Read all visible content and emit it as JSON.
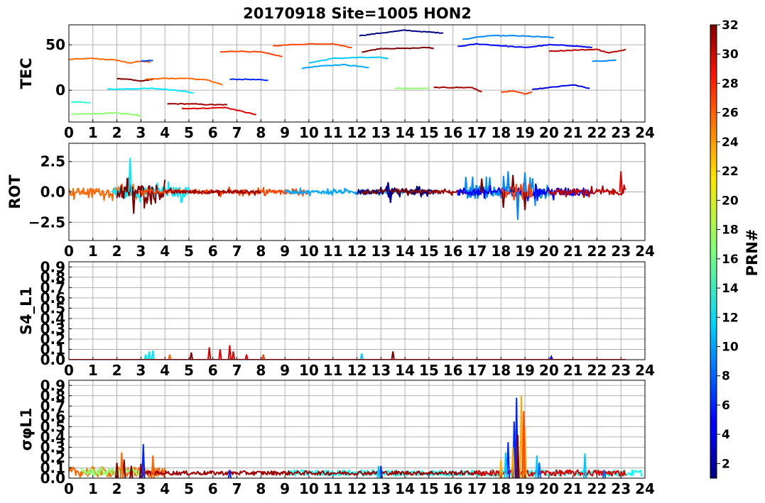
{
  "figure": {
    "title": "20170918 Site=1005 HON2",
    "colorbar": {
      "label": "PRN#",
      "min": 1,
      "max": 32,
      "ticks": [
        2,
        4,
        6,
        8,
        10,
        12,
        14,
        16,
        18,
        20,
        22,
        24,
        26,
        28,
        30,
        32
      ]
    }
  },
  "chart_data": [
    {
      "type": "line",
      "panel": "TEC",
      "ylabel": "TEC",
      "xlim": [
        0,
        24
      ],
      "ylim": [
        -35,
        72
      ],
      "xticks": [
        "0",
        "1",
        "2",
        "3",
        "4",
        "5",
        "6",
        "7",
        "8",
        "9",
        "10",
        "11",
        "12",
        "13",
        "14",
        "15",
        "16",
        "17",
        "18",
        "19",
        "20",
        "21",
        "22",
        "23",
        "24"
      ],
      "yticks": [
        {
          "v": 50,
          "label": "50"
        },
        {
          "v": 0,
          "label": "0"
        }
      ],
      "grid": true,
      "series": [
        {
          "prn": 25,
          "x": [
            0,
            1.0,
            2.0,
            2.5,
            3.0,
            3.4
          ],
          "y": [
            34,
            35,
            33,
            30,
            32,
            31
          ]
        },
        {
          "prn": 7,
          "x": [
            3.0,
            3.5
          ],
          "y": [
            32,
            33
          ]
        },
        {
          "prn": 32,
          "x": [
            2.0,
            2.5,
            3.0,
            3.5
          ],
          "y": [
            13,
            12,
            10,
            12
          ]
        },
        {
          "prn": 25,
          "x": [
            3.2,
            4.0,
            5.0,
            5.8,
            6.4
          ],
          "y": [
            12,
            13,
            13,
            11,
            6
          ]
        },
        {
          "prn": 12,
          "x": [
            1.6,
            2.5,
            3.5,
            4.5,
            5.2
          ],
          "y": [
            1,
            1.5,
            2,
            0,
            -3
          ]
        },
        {
          "prn": 14,
          "x": [
            0.1,
            0.5,
            0.9
          ],
          "y": [
            -13,
            -13,
            -14
          ]
        },
        {
          "prn": 17,
          "x": [
            0.1,
            1.0,
            2.0,
            2.8,
            3.0
          ],
          "y": [
            -26,
            -26,
            -25,
            -27,
            -29
          ]
        },
        {
          "prn": 31,
          "x": [
            4.1,
            5.0,
            6.0,
            6.6
          ],
          "y": [
            -15,
            -15,
            -16,
            -16
          ]
        },
        {
          "prn": 29,
          "x": [
            4.7,
            5.5,
            6.5,
            7.0,
            7.8
          ],
          "y": [
            -20,
            -20,
            -19,
            -22,
            -27
          ]
        },
        {
          "prn": 26,
          "x": [
            6.3,
            7.0,
            8.0,
            8.9
          ],
          "y": [
            42,
            43,
            42,
            37
          ]
        },
        {
          "prn": 6,
          "x": [
            6.7,
            7.5,
            8.3
          ],
          "y": [
            12,
            12,
            11
          ]
        },
        {
          "prn": 26,
          "x": [
            8.5,
            10.0,
            11.0,
            11.8
          ],
          "y": [
            49,
            51,
            51,
            47
          ]
        },
        {
          "prn": 10,
          "x": [
            9.7,
            10.5,
            11.5,
            12.5
          ],
          "y": [
            24,
            27,
            28,
            25
          ]
        },
        {
          "prn": 11,
          "x": [
            10.0,
            11.0,
            12.0,
            13.0,
            13.3
          ],
          "y": [
            30,
            35,
            36,
            36,
            35
          ]
        },
        {
          "prn": 1,
          "x": [
            12.1,
            13.0,
            14.0,
            15.0,
            15.6
          ],
          "y": [
            60,
            63,
            66,
            64,
            63
          ]
        },
        {
          "prn": 32,
          "x": [
            12.2,
            13.0,
            14.0,
            15.0,
            15.2
          ],
          "y": [
            42,
            46,
            46,
            47,
            46
          ]
        },
        {
          "prn": 17,
          "x": [
            13.6,
            14.3,
            15.0
          ],
          "y": [
            2,
            2,
            2
          ]
        },
        {
          "prn": 31,
          "x": [
            15.2,
            16.0,
            16.8,
            17.2
          ],
          "y": [
            3,
            3,
            3,
            -2
          ]
        },
        {
          "prn": 9,
          "x": [
            16.4,
            17.5,
            18.5,
            19.5,
            20.2
          ],
          "y": [
            56,
            60,
            60,
            59,
            58
          ]
        },
        {
          "prn": 5,
          "x": [
            16.2,
            17.0,
            18.0,
            19.0,
            20.0,
            21.0,
            21.8
          ],
          "y": [
            48,
            51,
            49,
            47,
            50,
            49,
            47
          ]
        },
        {
          "prn": 26,
          "x": [
            18.0,
            18.5,
            19.0,
            19.3
          ],
          "y": [
            -2,
            -1,
            -4,
            -2
          ]
        },
        {
          "prn": 4,
          "x": [
            19.3,
            20.0,
            21.0,
            21.7
          ],
          "y": [
            1,
            3,
            6,
            2
          ]
        },
        {
          "prn": 30,
          "x": [
            20.0,
            21.0,
            22.0,
            22.5,
            23.2
          ],
          "y": [
            43,
            44,
            45,
            41,
            45
          ]
        },
        {
          "prn": 9,
          "x": [
            21.8,
            22.8
          ],
          "y": [
            32,
            33
          ]
        }
      ]
    },
    {
      "type": "line",
      "panel": "ROT",
      "ylabel": "ROT",
      "xlim": [
        0,
        24
      ],
      "ylim": [
        -4,
        4
      ],
      "xticks": [
        "0",
        "1",
        "2",
        "3",
        "4",
        "5",
        "6",
        "7",
        "8",
        "9",
        "10",
        "11",
        "12",
        "13",
        "14",
        "15",
        "16",
        "17",
        "18",
        "19",
        "20",
        "21",
        "22",
        "23",
        "24"
      ],
      "yticks": [
        {
          "v": 2.5,
          "label": "2.5"
        },
        {
          "v": 0,
          "label": "0.0"
        },
        {
          "v": -2.5,
          "label": "−2.5"
        }
      ],
      "grid": true,
      "series": [
        {
          "prn": 25,
          "kind": "noise",
          "xs": 0.0,
          "xe": 3.5,
          "amp": 0.45
        },
        {
          "prn": 12,
          "kind": "noise",
          "xs": 1.8,
          "xe": 5.0,
          "amp": 0.6
        },
        {
          "prn": 32,
          "kind": "noise",
          "xs": 2.0,
          "xe": 4.0,
          "amp": 0.9
        },
        {
          "prn": 26,
          "kind": "noise",
          "xs": 3.0,
          "xe": 10.0,
          "amp": 0.25
        },
        {
          "prn": 31,
          "kind": "noise",
          "xs": 4.0,
          "xe": 8.0,
          "amp": 0.2
        },
        {
          "prn": 10,
          "kind": "noise",
          "xs": 9.0,
          "xe": 14.0,
          "amp": 0.2
        },
        {
          "prn": 1,
          "kind": "noise",
          "xs": 12.0,
          "xe": 15.5,
          "amp": 0.3
        },
        {
          "prn": 32,
          "kind": "noise",
          "xs": 12.2,
          "xe": 15.2,
          "amp": 0.25
        },
        {
          "prn": 31,
          "kind": "noise",
          "xs": 15.2,
          "xe": 17.5,
          "amp": 0.2
        },
        {
          "prn": 9,
          "kind": "noise",
          "xs": 16.5,
          "xe": 20.0,
          "amp": 0.8
        },
        {
          "prn": 5,
          "kind": "noise",
          "xs": 16.2,
          "xe": 21.8,
          "amp": 0.5
        },
        {
          "prn": 26,
          "kind": "noise",
          "xs": 18.0,
          "xe": 19.3,
          "amp": 1.0
        },
        {
          "prn": 30,
          "kind": "noise",
          "xs": 20.0,
          "xe": 23.2,
          "amp": 0.35
        },
        {
          "prn": 32,
          "kind": "spikes",
          "x": [
            2.5,
            2.7,
            17.2,
            18.1,
            18.5,
            19.0
          ],
          "y": [
            1.2,
            -1.8,
            1.1,
            -1.3,
            1.4,
            -1.5
          ]
        },
        {
          "prn": 12,
          "kind": "spikes",
          "x": [
            2.55
          ],
          "y": [
            2.8
          ]
        },
        {
          "prn": 9,
          "kind": "spikes",
          "x": [
            18.3,
            18.7,
            19.0
          ],
          "y": [
            1.7,
            -2.3,
            1.6
          ]
        },
        {
          "prn": 2,
          "kind": "spikes",
          "x": [
            13.3,
            13.4
          ],
          "y": [
            0.8,
            -0.9
          ]
        },
        {
          "prn": 29,
          "kind": "spikes",
          "x": [
            23.0
          ],
          "y": [
            1.7
          ]
        }
      ]
    },
    {
      "type": "line",
      "panel": "S4",
      "ylabel": "S4_L1",
      "xlim": [
        0,
        24
      ],
      "ylim": [
        0,
        0.95
      ],
      "xticks": [
        "0",
        "1",
        "2",
        "3",
        "4",
        "5",
        "6",
        "7",
        "8",
        "9",
        "10",
        "11",
        "12",
        "13",
        "14",
        "15",
        "16",
        "17",
        "18",
        "19",
        "20",
        "21",
        "22",
        "23",
        "24"
      ],
      "yticks": [
        {
          "v": 0.9,
          "label": "0.9"
        },
        {
          "v": 0.8,
          "label": "0.8"
        },
        {
          "v": 0.7,
          "label": "0.7"
        },
        {
          "v": 0.6,
          "label": "0.6"
        },
        {
          "v": 0.5,
          "label": "0.5"
        },
        {
          "v": 0.4,
          "label": "0.4"
        },
        {
          "v": 0.3,
          "label": "0.3"
        },
        {
          "v": 0.2,
          "label": "0.2"
        },
        {
          "v": 0.1,
          "label": "0.1"
        },
        {
          "v": 0.0,
          "label": "0.0"
        }
      ],
      "grid": true,
      "series": [
        {
          "prn": 12,
          "kind": "spikes",
          "x": [
            3.2,
            3.35,
            3.5
          ],
          "y": [
            0.05,
            0.08,
            0.09
          ]
        },
        {
          "prn": 25,
          "kind": "spikes",
          "x": [
            4.2
          ],
          "y": [
            0.05
          ]
        },
        {
          "prn": 32,
          "kind": "spikes",
          "x": [
            5.1
          ],
          "y": [
            0.07
          ]
        },
        {
          "prn": 29,
          "kind": "spikes",
          "x": [
            5.85,
            6.3,
            6.7,
            6.85,
            7.4
          ],
          "y": [
            0.12,
            0.1,
            0.14,
            0.08,
            0.05
          ]
        },
        {
          "prn": 26,
          "kind": "spikes",
          "x": [
            8.1
          ],
          "y": [
            0.05
          ]
        },
        {
          "prn": 11,
          "kind": "spikes",
          "x": [
            12.2
          ],
          "y": [
            0.06
          ]
        },
        {
          "prn": 32,
          "kind": "spikes",
          "x": [
            13.5
          ],
          "y": [
            0.08
          ]
        },
        {
          "prn": 5,
          "kind": "spikes",
          "x": [
            20.1
          ],
          "y": [
            0.03
          ]
        },
        {
          "prn": 28,
          "kind": "baseline",
          "xs": 0.0,
          "xe": 23.2,
          "y": 0.0
        }
      ]
    },
    {
      "type": "line",
      "panel": "SIGMA",
      "ylabel": "σφL1",
      "xlim": [
        0,
        24
      ],
      "ylim": [
        0,
        0.95
      ],
      "xticks": [
        "0",
        "1",
        "2",
        "3",
        "4",
        "5",
        "6",
        "7",
        "8",
        "9",
        "10",
        "11",
        "12",
        "13",
        "14",
        "15",
        "16",
        "17",
        "18",
        "19",
        "20",
        "21",
        "22",
        "23",
        "24"
      ],
      "yticks": [
        {
          "v": 0.9,
          "label": "0.9"
        },
        {
          "v": 0.8,
          "label": "0.8"
        },
        {
          "v": 0.7,
          "label": "0.7"
        },
        {
          "v": 0.6,
          "label": "0.6"
        },
        {
          "v": 0.5,
          "label": "0.5"
        },
        {
          "v": 0.4,
          "label": "0.4"
        },
        {
          "v": 0.3,
          "label": "0.3"
        },
        {
          "v": 0.2,
          "label": "0.2"
        },
        {
          "v": 0.1,
          "label": "0.1"
        },
        {
          "v": 0.0,
          "label": "0.0"
        }
      ],
      "grid": true,
      "series": [
        {
          "prn": 25,
          "kind": "noiseabs",
          "xs": 0.0,
          "xe": 4.0,
          "base": 0.06,
          "amp": 0.05
        },
        {
          "prn": 17,
          "kind": "noiseabs",
          "xs": 0.5,
          "xe": 3.0,
          "base": 0.06,
          "amp": 0.04
        },
        {
          "prn": 13,
          "kind": "noiseabs",
          "xs": 9.0,
          "xe": 23.9,
          "base": 0.05,
          "amp": 0.03
        },
        {
          "prn": 31,
          "kind": "noiseabs",
          "xs": 3.0,
          "xe": 17.3,
          "base": 0.05,
          "amp": 0.02
        },
        {
          "prn": 29,
          "kind": "noiseabs",
          "xs": 17.0,
          "xe": 23.2,
          "base": 0.05,
          "amp": 0.03
        },
        {
          "prn": 32,
          "kind": "spikes",
          "x": [
            2.0,
            2.3,
            2.6,
            3.0
          ],
          "y": [
            0.15,
            0.18,
            0.12,
            0.14
          ]
        },
        {
          "prn": 25,
          "kind": "spikes",
          "x": [
            2.2,
            3.1,
            3.5
          ],
          "y": [
            0.25,
            0.28,
            0.22
          ]
        },
        {
          "prn": 6,
          "kind": "spikes",
          "x": [
            3.1,
            6.7,
            13.0,
            18.3,
            18.55,
            18.65
          ],
          "y": [
            0.33,
            0.08,
            0.12,
            0.35,
            0.55,
            0.78
          ]
        },
        {
          "prn": 11,
          "kind": "spikes",
          "x": [
            12.9,
            18.2,
            19.5,
            21.5
          ],
          "y": [
            0.12,
            0.25,
            0.22,
            0.24
          ]
        },
        {
          "prn": 23,
          "kind": "spikes",
          "x": [
            18.0,
            18.5,
            18.85,
            19.0
          ],
          "y": [
            0.18,
            0.3,
            0.8,
            0.5
          ]
        },
        {
          "prn": 26,
          "kind": "spikes",
          "x": [
            18.95
          ],
          "y": [
            0.65
          ]
        },
        {
          "prn": 32,
          "kind": "spikes",
          "x": [
            18.7
          ],
          "y": [
            0.42
          ]
        },
        {
          "prn": 8,
          "kind": "spikes",
          "x": [
            19.6,
            22.3
          ],
          "y": [
            0.15,
            0.08
          ]
        }
      ]
    }
  ]
}
